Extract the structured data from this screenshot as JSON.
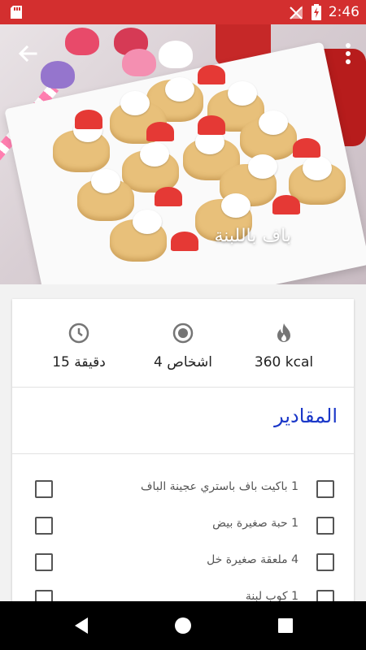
{
  "status_bar": {
    "time": "2:46",
    "icons": [
      "sd-card-icon",
      "no-signal-icon",
      "battery-charging-icon"
    ]
  },
  "recipe": {
    "title": "باف باللبنة",
    "stats": {
      "calories": "360 kcal",
      "servings": "4 اشخاص",
      "time": "15 دقيقة"
    },
    "ingredients_heading": "المقادير",
    "ingredients": [
      {
        "text": "1 باكيت   باف باستري عجينة الباف",
        "checked": false
      },
      {
        "text": "1 حبة صغيرة   بيض",
        "checked": false
      },
      {
        "text": "4 ملعقة صغيرة   خل",
        "checked": false
      },
      {
        "text": "1 كوب   لبنة",
        "checked": false
      }
    ]
  },
  "colors": {
    "status_bar": "#d32f2f",
    "accent": "#1a37c8",
    "nav_bar": "#000000"
  },
  "nav_bar": {
    "icons": [
      "back-triangle-icon",
      "home-circle-icon",
      "recents-square-icon"
    ]
  }
}
